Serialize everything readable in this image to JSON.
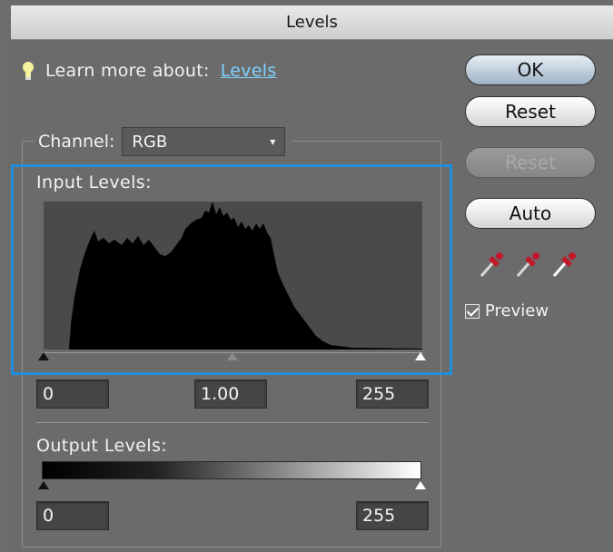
{
  "window": {
    "title": "Levels"
  },
  "learn_more": {
    "text": "Learn more about:",
    "link": "Levels"
  },
  "buttons": {
    "ok": "OK",
    "reset": "Reset",
    "reset_disabled": "Reset",
    "auto": "Auto"
  },
  "preview": {
    "label": "Preview",
    "checked": true
  },
  "channel": {
    "label": "Channel:",
    "value": "RGB"
  },
  "input_levels": {
    "label": "Input Levels:",
    "black": "0",
    "gamma": "1.00",
    "white": "255"
  },
  "output_levels": {
    "label": "Output Levels:",
    "black": "0",
    "white": "255"
  },
  "colors": {
    "highlight": "#1f8fd9",
    "link": "#7fd2ff",
    "panel": "#6b6b6b"
  },
  "icons": [
    "lightbulb-icon",
    "black-point-eyedropper-icon",
    "gray-point-eyedropper-icon",
    "white-point-eyedropper-icon",
    "checkbox-check-icon",
    "chevron-down-icon"
  ]
}
